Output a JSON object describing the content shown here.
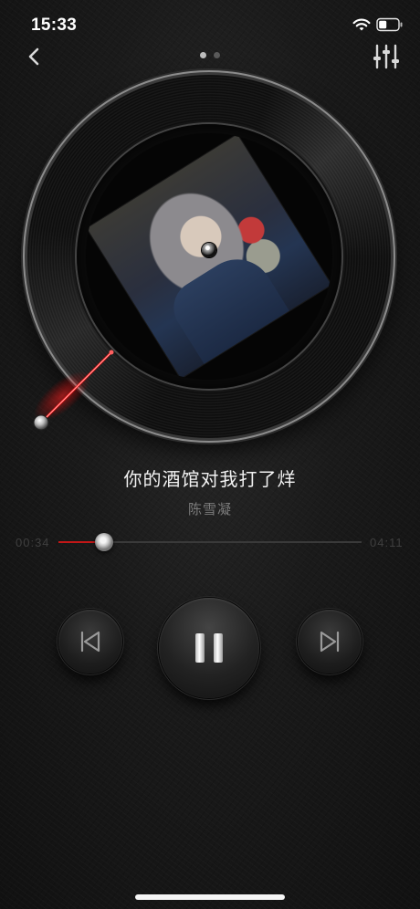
{
  "status_bar": {
    "time": "15:33"
  },
  "nav": {
    "back_icon": "chevron-left-icon",
    "settings_icon": "equalizer-icon",
    "pages": 2,
    "active_page": 0
  },
  "player": {
    "song_title": "你的酒馆对我打了烊",
    "artist": "陈雪凝",
    "elapsed": "00:34",
    "duration": "04:11",
    "progress": 0.15,
    "state": "playing"
  },
  "controls": {
    "prev_icon": "previous-icon",
    "pause_icon": "pause-icon",
    "next_icon": "next-icon"
  },
  "colors": {
    "accent": "#c21717",
    "background": "#151515",
    "text": "#f2f2f2",
    "subtext": "#7b7b7b"
  }
}
